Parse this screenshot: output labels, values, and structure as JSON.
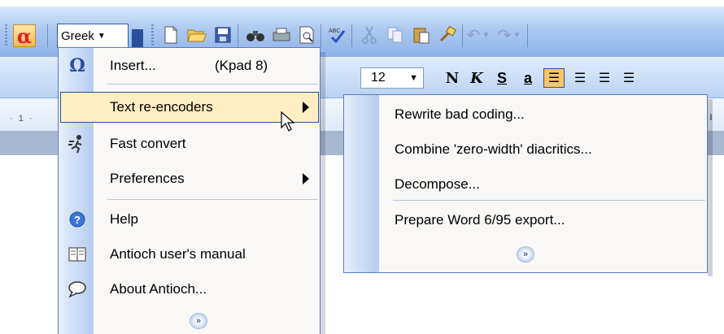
{
  "toolbar": {
    "alpha_label": "α",
    "language_value": "Greek",
    "font_size_value": "12",
    "format_bold": "N",
    "format_italic": "K",
    "format_strike": "S",
    "format_a": "a"
  },
  "ruler": {
    "text": "· 1 ·",
    "right_tick": "ı"
  },
  "main_menu": {
    "items": [
      {
        "label": "Insert...",
        "shortcut": "(Kpad 8)",
        "icon": "omega-icon"
      },
      {
        "label": "Text re-encoders",
        "icon": "none",
        "submenu": true,
        "highlighted": true
      },
      {
        "label": "Fast convert",
        "icon": "running-man-icon"
      },
      {
        "label": "Preferences",
        "icon": "none",
        "submenu": true
      },
      {
        "label": "Help",
        "icon": "help-icon"
      },
      {
        "label": "Antioch user's manual",
        "icon": "book-icon"
      },
      {
        "label": "About Antioch...",
        "icon": "speech-bubble-icon"
      }
    ],
    "expand_glyph": "»"
  },
  "sub_menu": {
    "items": [
      {
        "label": "Rewrite bad coding..."
      },
      {
        "label": "Combine 'zero-width' diacritics..."
      },
      {
        "label": "Decompose..."
      },
      {
        "label": "Prepare Word 6/95 export..."
      }
    ],
    "expand_glyph": "»"
  },
  "colors": {
    "highlight": "#ffeec2",
    "menu_border": "#5b7bbd",
    "toolbar": "#a8c6f0"
  }
}
